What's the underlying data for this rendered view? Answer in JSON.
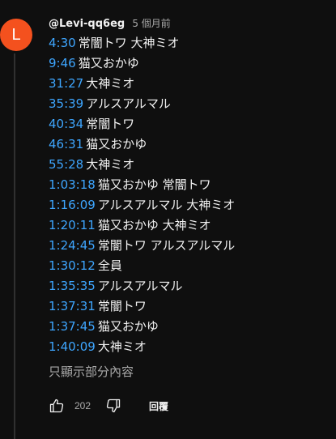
{
  "comment": {
    "avatar_letter": "L",
    "avatar_color": "#f4511e",
    "author": "@Levi-qq6eg",
    "time_ago": "5 個月前",
    "lines": [
      {
        "timestamp": "4:30",
        "text": "常闇トワ 大神ミオ"
      },
      {
        "timestamp": "9:46",
        "text": "猫又おかゆ"
      },
      {
        "timestamp": "31:27",
        "text": "大神ミオ"
      },
      {
        "timestamp": "35:39",
        "text": "アルスアルマル"
      },
      {
        "timestamp": "40:34",
        "text": "常闇トワ"
      },
      {
        "timestamp": "46:31",
        "text": "猫又おかゆ"
      },
      {
        "timestamp": "55:28",
        "text": "大神ミオ"
      },
      {
        "timestamp": "1:03:18",
        "text": "猫又おかゆ 常闇トワ"
      },
      {
        "timestamp": "1:16:09",
        "text": "アルスアルマル 大神ミオ"
      },
      {
        "timestamp": "1:20:11",
        "text": "猫又おかゆ 大神ミオ"
      },
      {
        "timestamp": "1:24:45",
        "text": "常闇トワ アルスアルマル"
      },
      {
        "timestamp": "1:30:12",
        "text": "全員"
      },
      {
        "timestamp": "1:35:35",
        "text": "アルスアルマル"
      },
      {
        "timestamp": "1:37:31",
        "text": "常闇トワ"
      },
      {
        "timestamp": "1:37:45",
        "text": "猫又おかゆ"
      },
      {
        "timestamp": "1:40:09",
        "text": "大神ミオ"
      }
    ],
    "show_less_label": "只顯示部分內容",
    "like_count": "202",
    "reply_label": "回覆",
    "timestamp_color": "#3ea6ff"
  },
  "icons": {
    "like": "thumb-up-icon",
    "dislike": "thumb-down-icon"
  }
}
